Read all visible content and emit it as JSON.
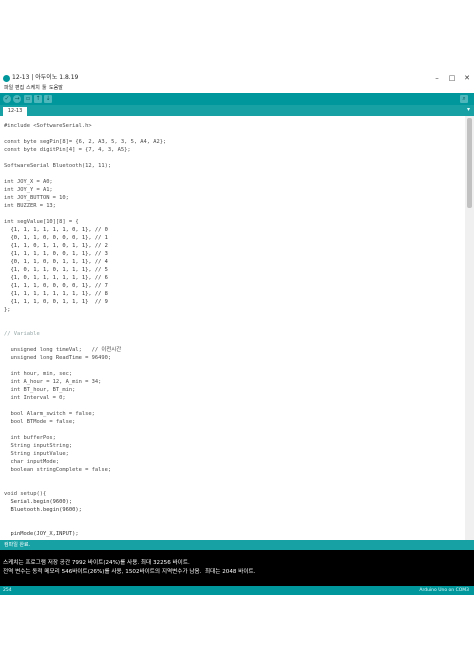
{
  "window": {
    "title": "12-13 | 아두이노 1.8.19",
    "controls": [
      "–",
      "□",
      "✕"
    ]
  },
  "menu": [
    "파일",
    "편집",
    "스케치",
    "툴",
    "도움말"
  ],
  "toolbar": {
    "buttons": [
      {
        "name": "verify-button",
        "icon": "check-icon",
        "glyph": "✓"
      },
      {
        "name": "upload-button",
        "icon": "arrow-right-icon",
        "glyph": "→"
      },
      {
        "name": "new-button",
        "icon": "new-file-icon",
        "glyph": "▫"
      },
      {
        "name": "open-button",
        "icon": "open-icon",
        "glyph": "↑"
      },
      {
        "name": "save-button",
        "icon": "save-icon",
        "glyph": "↓"
      }
    ],
    "serial_monitor_glyph": "⌕"
  },
  "tabs": {
    "active": "12-13",
    "menu_glyph": "▾"
  },
  "code": [
    "#include <SoftwareSerial.h>",
    "",
    "const byte segPin[8]= {6, 2, A3, 5, 3, 5, A4, A2};",
    "const byte digitPin[4] = {7, 4, 3, A5};",
    "",
    "SoftwareSerial Bluetooth(12, 11);",
    "",
    "int JOY_X = A0;",
    "int JOY_Y = A1;",
    "int JOY_BUTTON = 10;",
    "int BUZZER = 13;",
    "",
    "int segValue[10][8] = {",
    "  {1, 1, 1, 1, 1, 1, 0, 1}, // 0",
    "  {0, 1, 1, 0, 0, 0, 0, 1}, // 1",
    "  {1, 1, 0, 1, 1, 0, 1, 1}, // 2",
    "  {1, 1, 1, 1, 0, 0, 1, 1}, // 3",
    "  {0, 1, 1, 0, 0, 1, 1, 1}, // 4",
    "  {1, 0, 1, 1, 0, 1, 1, 1}, // 5",
    "  {1, 0, 1, 1, 1, 1, 1, 1}, // 6",
    "  {1, 1, 1, 0, 0, 0, 0, 1}, // 7",
    "  {1, 1, 1, 1, 1, 1, 1, 1}, // 8",
    "  {1, 1, 1, 0, 0, 1, 1, 1}  // 9",
    "};",
    "",
    "",
    "// Variable",
    "",
    "  unsigned long timeVal;   // 이전시간",
    "  unsigned long ReadTime = 96490;",
    "",
    "  int hour, min, sec;",
    "  int A_hour = 12, A_min = 34;",
    "  int BT_hour, BT_min;",
    "  int Interval = 0;",
    "",
    "  bool Alarm_switch = false;",
    "  bool BTMode = false;",
    "",
    "  int bufferPos;",
    "  String inputString;",
    "  String inputValue;",
    "  char inputMode;",
    "  boolean stringComplete = false;",
    "",
    "",
    "void setup(){",
    "  Serial.begin(9600);",
    "  Bluetooth.begin(9600);",
    "",
    "",
    "  pinMode(JOY_X,INPUT);"
  ],
  "status": "컴파일 완료.",
  "console": [
    "스케치는 프로그램 저장 공간 7992 바이트(24%)를 사용. 최대 32256 바이트.",
    "전역 변수는 동적 메모리 546바이트(26%)를 사용, 1502바이트의 지역변수가 남음.  최대는 2048 바이트."
  ],
  "footer": {
    "line": "254",
    "board": "Arduino Uno on COM3"
  }
}
